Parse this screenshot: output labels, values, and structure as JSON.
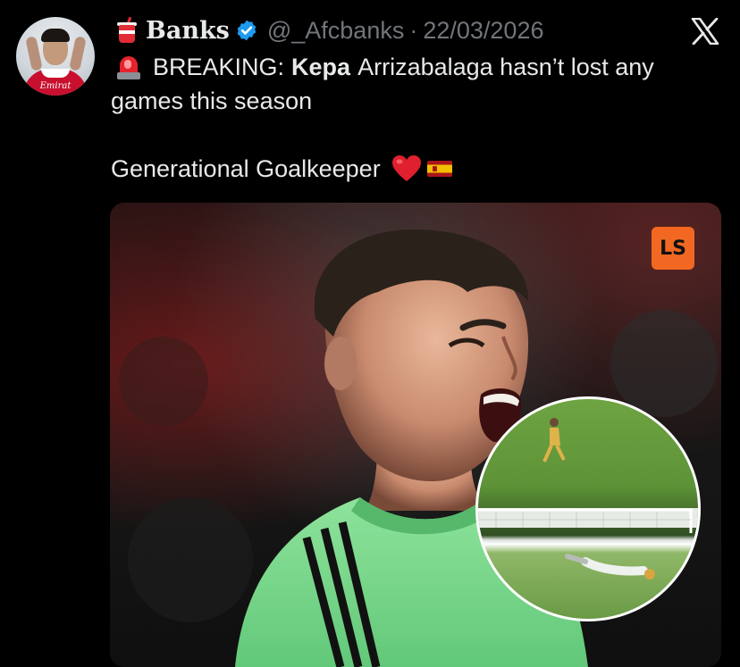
{
  "tweet": {
    "display_name": "Banks",
    "handle": "@_Afcbanks",
    "separator": "·",
    "date": "22/03/2026",
    "text": {
      "prefix": "BREAKING:",
      "bold": "Kepa",
      "rest": "Arrizabalaga hasn’t lost any",
      "line2": "games this season",
      "line3": "Generational Goalkeeper"
    }
  },
  "avatar": {
    "shirt_text": "Emirat"
  },
  "media": {
    "badge_label": "LS"
  },
  "icons": {
    "cup": "cup-with-straw-emoji",
    "verified": "verified-badge",
    "platform_logo": "x-logo",
    "siren": "police-light-emoji",
    "heart": "red-heart-emoji",
    "flag": "spain-flag-emoji"
  },
  "colors": {
    "background": "#000000",
    "text_primary": "#e7e9ea",
    "text_secondary": "#71767b",
    "verified_blue": "#1d9bf0",
    "badge_orange": "#f26822",
    "jersey_green": "#7bd88a"
  }
}
